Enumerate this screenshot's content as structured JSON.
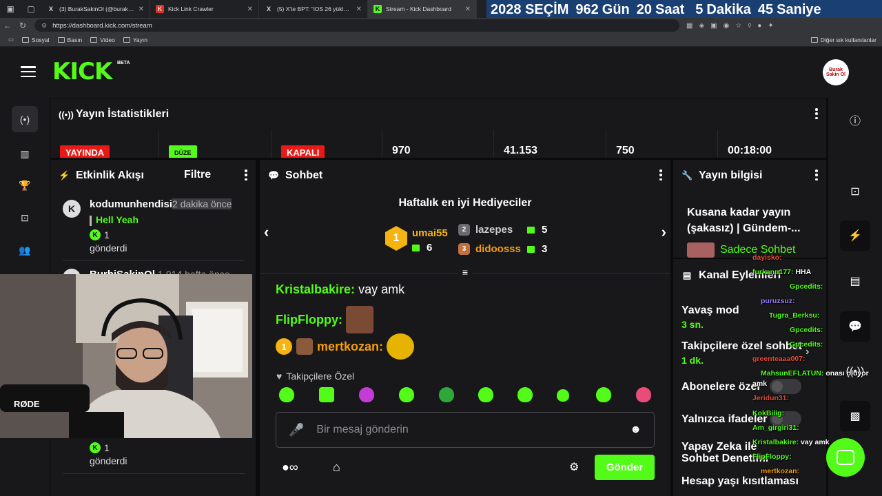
{
  "browser": {
    "tabs": [
      {
        "icon": "X",
        "label": "(3) BurakSakinOl (@buraktut_) / X",
        "active": false
      },
      {
        "icon": "K",
        "label": "Kick Link Crawler",
        "active": false
      },
      {
        "icon": "X",
        "label": "(5) X'te BPT: \"iOS 26 yükleyen bir",
        "active": false
      },
      {
        "icon": "K",
        "label": "Stream - Kick Dashboard",
        "active": true
      }
    ],
    "url": "https://dashboard.kick.com/stream",
    "bookmarks": [
      "Sosyal",
      "Basın",
      "Video",
      "Yayın"
    ],
    "bookmarks_right": "Diğer sık kullanılanlar"
  },
  "countdown": {
    "title": "2028 SEÇİM",
    "days": "962",
    "days_label": "Gün",
    "hours": "20",
    "hours_label": "Saat",
    "minutes": "5",
    "minutes_label": "Dakika",
    "seconds": "45",
    "seconds_label": "Saniye"
  },
  "header": {
    "logo": "KICK",
    "beta": "BETA",
    "avatar_text": "Burak Sakin Ol"
  },
  "stats": {
    "title": "Yayın İstatistikleri",
    "badges": [
      "YAYINDA",
      "DÜZE",
      "KAPALI"
    ],
    "values": [
      "970",
      "41.153",
      "750",
      "00:18:00"
    ]
  },
  "activity": {
    "title": "Etkinlik Akışı",
    "filter": "Filtre",
    "item1": {
      "avatar": "K",
      "user": "kodumunhendisi",
      "time": "2 dakika önce",
      "message": "Hell Yeah",
      "count": "1",
      "action": "gönderdi"
    },
    "item2": {
      "user": "BurhiSakinOl",
      "time": "1.914 hafta önce"
    },
    "item3": {
      "count": "1",
      "action": "gönderdi"
    }
  },
  "chat": {
    "title": "Sohbet",
    "top_gifters_title": "Haftalık en iyi Hediyeciler",
    "gifters": [
      {
        "rank": "1",
        "name": "umai55",
        "count": "6"
      },
      {
        "rank": "2",
        "name": "lazepes",
        "count": "5"
      },
      {
        "rank": "3",
        "name": "didoosss",
        "count": "3"
      }
    ],
    "messages": [
      {
        "user": "Kristalbakire:",
        "text": "vay amk"
      },
      {
        "user": "FlipFloppy:",
        "text": ""
      },
      {
        "user": "mertkozan:",
        "text": ""
      }
    ],
    "followers_only": "Takipçilere Özel",
    "input_placeholder": "Bir mesaj gönderin",
    "send": "Gönder"
  },
  "stream_info": {
    "title": "Yayın bilgisi",
    "stream_title": "Kusana kadar yayın (şakasız) | Gündem-...",
    "category": "Sadece Sohbet"
  },
  "channel_actions": {
    "title": "Kanal Eylemleri",
    "slow_mode": "Yavaş mod",
    "slow_value": "3 sn.",
    "followers": "Takipçilere özel sohbet",
    "followers_value": "1 dk.",
    "subs": "Abonelere özel",
    "emotes": "Yalnızca ifadeler",
    "ai": "Yapay Zeka ile Sohbet Denetimi",
    "age": "Hesap yaşı kısıtlaması"
  },
  "overlay_chat": [
    {
      "user": "dayisko:",
      "text": ""
    },
    {
      "user": "furkann177:",
      "text": "HHA"
    },
    {
      "user": "Gpcedits:",
      "text": ""
    },
    {
      "user": "puruzsuz:",
      "text": ""
    },
    {
      "user": "Tugra_Berksu:",
      "text": ""
    },
    {
      "user": "Gpcedits:",
      "text": ""
    },
    {
      "user": "Gpcedits:",
      "text": ""
    },
    {
      "user": "greenteaaa007:",
      "text": ""
    },
    {
      "user": "MahsunEFLATUN:",
      "text": "onası oluyor"
    },
    {
      "user": "",
      "text": "amk"
    },
    {
      "user": "Jeridun31:",
      "text": ""
    },
    {
      "user": "KokBilig:",
      "text": ""
    },
    {
      "user": "Am_girgiri31:",
      "text": ""
    },
    {
      "user": "Kristalbakire:",
      "text": "vay amk"
    },
    {
      "user": "FlipFloppy:",
      "text": ""
    },
    {
      "user": "mertkozan:",
      "text": ""
    }
  ],
  "colors": {
    "accent": "#53fc18",
    "live": "#e91916",
    "panel": "#18181b",
    "banner": "#1a3f73"
  }
}
